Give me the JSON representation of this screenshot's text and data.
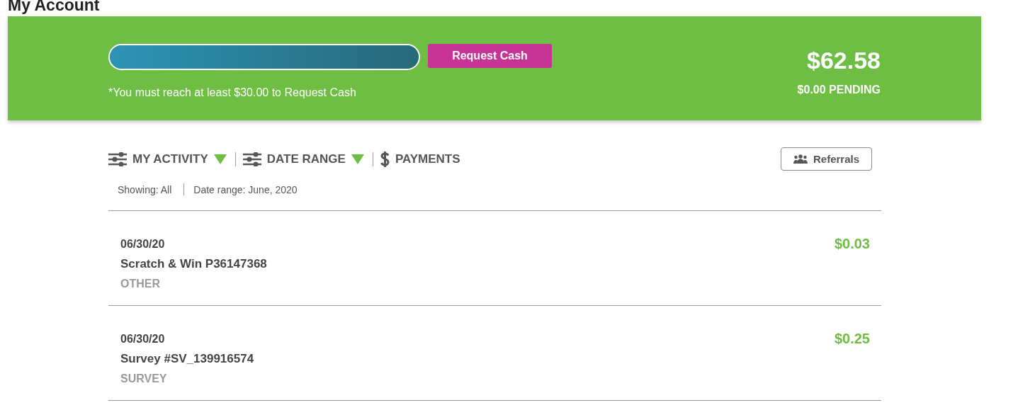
{
  "page": {
    "title": "My Account"
  },
  "balance_card": {
    "progress": {
      "level": 1
    },
    "request_button": "Request Cash",
    "note": "*You must reach at least $30.00 to Request Cash",
    "balance": "$62.58",
    "pending": "$0.00 PENDING"
  },
  "filters": [
    {
      "kind": "dropdown",
      "label": "MY ACTIVITY"
    },
    {
      "kind": "dropdown",
      "label": "DATE RANGE"
    },
    {
      "kind": "link",
      "label": "PAYMENTS"
    }
  ],
  "referrals_button": "Referrals",
  "summary": [
    "Showing: All",
    "Date range: June, 2020"
  ],
  "transactions": [
    {
      "date": "06/30/20",
      "title": "Scratch & Win P36147368",
      "category": "OTHER",
      "amount": "$0.03"
    },
    {
      "date": "06/30/20",
      "title": "Survey #SV_139916574",
      "category": "SURVEY",
      "amount": "$0.25"
    }
  ]
}
